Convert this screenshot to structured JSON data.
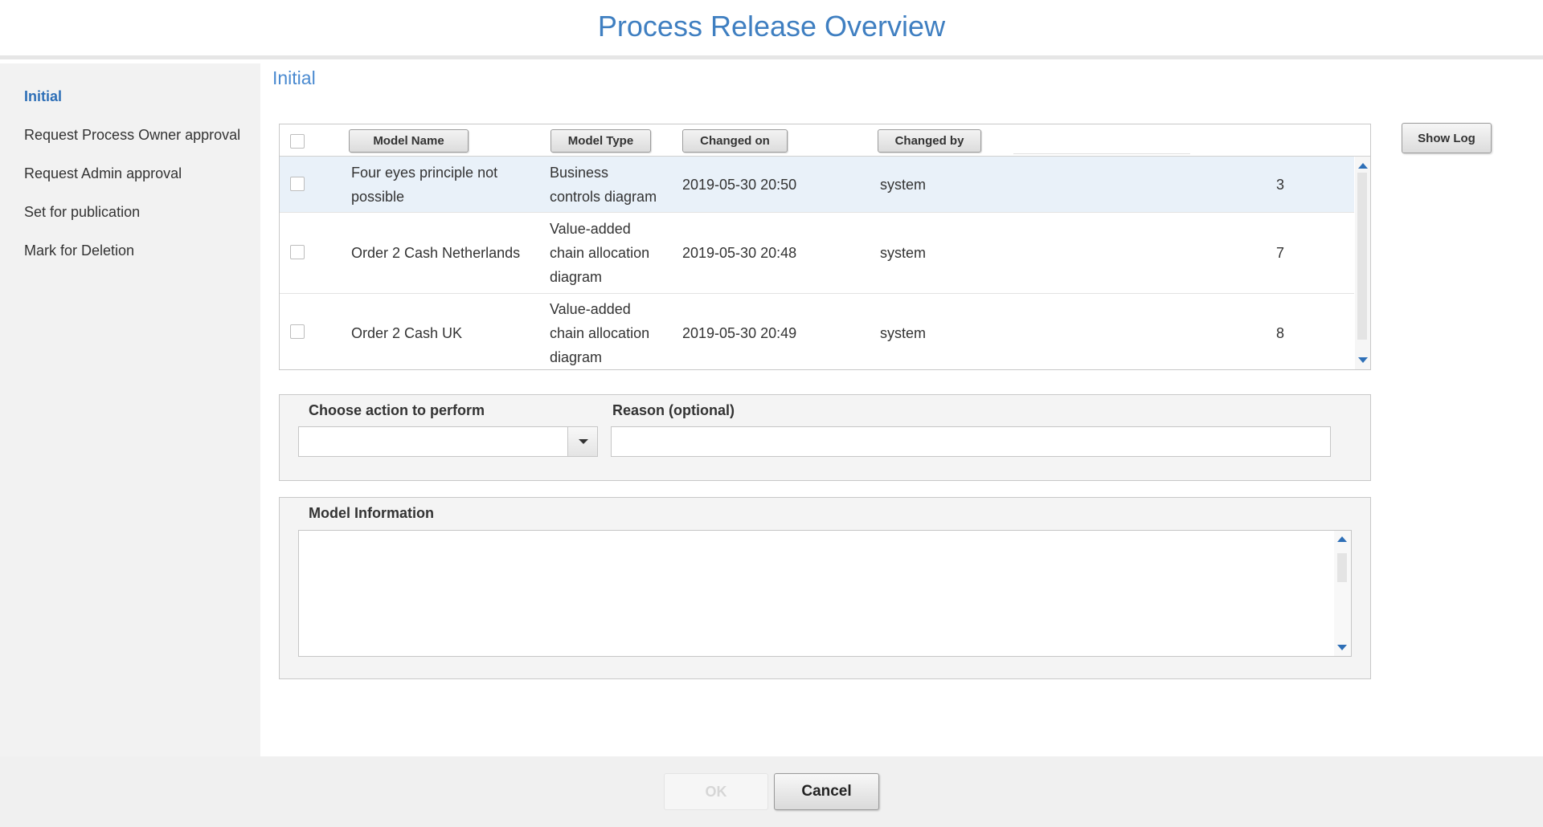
{
  "window": {
    "title": "Process Release Overview"
  },
  "sidebar": {
    "items": [
      {
        "label": "Initial",
        "active": true
      },
      {
        "label": "Request Process Owner approval",
        "active": false
      },
      {
        "label": "Request Admin approval",
        "active": false
      },
      {
        "label": "Set for publication",
        "active": false
      },
      {
        "label": "Mark for Deletion",
        "active": false
      }
    ]
  },
  "main": {
    "section_title": "Initial",
    "show_log_label": "Show Log",
    "table": {
      "columns": [
        "Model Name",
        "Model Type",
        "Changed on",
        "Changed by"
      ],
      "rows": [
        {
          "name_lines": [
            "Four eyes principle not",
            "possible"
          ],
          "type_lines": [
            "Business",
            "controls diagram"
          ],
          "changed_on": "2019-05-30 20:50",
          "changed_by": "system",
          "count": "3"
        },
        {
          "name_lines": [
            "Order 2 Cash Netherlands"
          ],
          "type_lines": [
            "Value-added",
            "chain allocation",
            "diagram"
          ],
          "changed_on": "2019-05-30 20:48",
          "changed_by": "system",
          "count": "7"
        },
        {
          "name_lines": [
            "Order 2 Cash UK"
          ],
          "type_lines": [
            "Value-added",
            "chain allocation",
            "diagram"
          ],
          "changed_on": "2019-05-30 20:49",
          "changed_by": "system",
          "count": "8"
        }
      ]
    },
    "action": {
      "label": "Choose action to perform",
      "selected": "",
      "reason_label": "Reason (optional)",
      "reason_value": ""
    },
    "model_info": {
      "label": "Model Information",
      "value": ""
    }
  },
  "footer": {
    "ok_label": "OK",
    "cancel_label": "Cancel"
  },
  "colors": {
    "accent": "#3f7fc1",
    "selected_row": "#e9f1f9",
    "panel_bg": "#f4f4f4"
  }
}
